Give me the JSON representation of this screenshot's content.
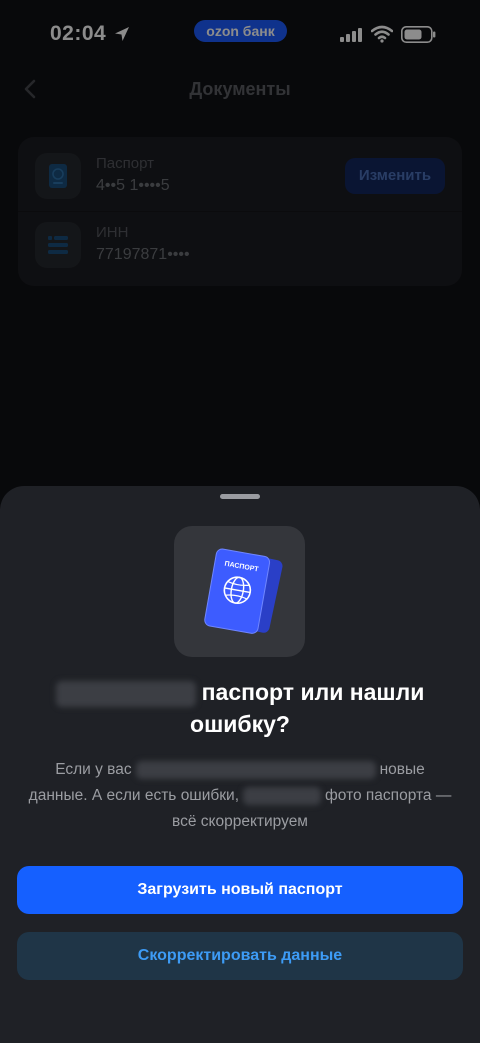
{
  "status_bar": {
    "time": "02:04",
    "pill_label": "ozon банк"
  },
  "header": {
    "title": "Документы"
  },
  "documents": [
    {
      "label": "Паспорт",
      "value": "4••5 1••••5",
      "action_label": "Изменить",
      "icon": "passport-icon"
    },
    {
      "label": "ИНН",
      "value": "77197871••••",
      "icon": "inn-list-icon"
    }
  ],
  "sheet": {
    "illustration": "passport-illustration",
    "title_line1": "паспорт или нашли",
    "title_line2": "ошибку?",
    "desc_part1": "Если у вас",
    "desc_part2": "новые данные. А если есть ошибки,",
    "desc_part3": "фото паспорта — всё скорректируем",
    "primary_label": "Загрузить новый паспорт",
    "secondary_label": "Скорректировать данные"
  },
  "colors": {
    "accent": "#1560ff",
    "secondary_text": "#3d9bf5",
    "sheet_bg": "#1f2126"
  }
}
